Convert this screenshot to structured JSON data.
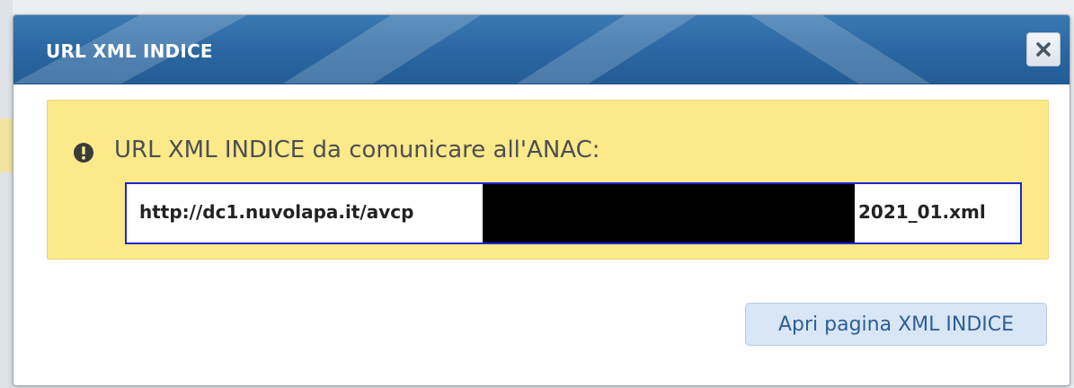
{
  "dialog": {
    "title": "URL XML INDICE",
    "close_icon": "close-icon"
  },
  "alert": {
    "icon": "exclamation-circle-icon",
    "message": "URL XML INDICE da comunicare all'ANAC:",
    "url_prefix": "http://dc1.nuvolapa.it/avcp",
    "url_suffix": "2021_01.xml"
  },
  "actions": {
    "open_button_label": "Apri pagina XML INDICE"
  },
  "colors": {
    "titlebar": "#2a66a1",
    "alert_background": "#fbe98a",
    "url_border": "#1f25d8",
    "button_background": "#d9e6f5",
    "button_text": "#2d5f96"
  }
}
